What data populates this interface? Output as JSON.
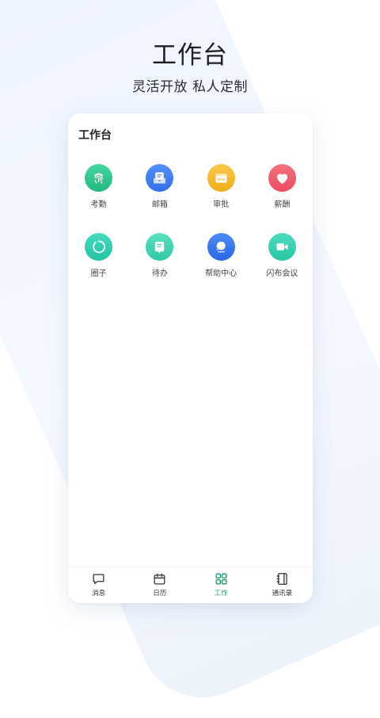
{
  "hero": {
    "title": "工作台",
    "subtitle": "灵活开放 私人定制"
  },
  "screen": {
    "title": "工作台"
  },
  "apps": [
    {
      "label": "考勤",
      "icon": "fingerprint-icon",
      "color": "#2fc58c"
    },
    {
      "label": "邮箱",
      "icon": "mail-icon",
      "color": "#3d7cf3"
    },
    {
      "label": "审批",
      "icon": "approval-icon",
      "color": "#f6ba2a"
    },
    {
      "label": "薪酬",
      "icon": "heart-icon",
      "color": "#f05a6a"
    },
    {
      "label": "圈子",
      "icon": "circle-icon",
      "color": "#31cfb2"
    },
    {
      "label": "待办",
      "icon": "todo-icon",
      "color": "#38d1ad"
    },
    {
      "label": "帮助中心",
      "icon": "help-icon",
      "color": "#3577ef"
    },
    {
      "label": "闪布会议",
      "icon": "video-icon",
      "color": "#34d2ad"
    }
  ],
  "approval_icon_text": "BPM",
  "tabs": [
    {
      "label": "消息",
      "icon": "message-icon",
      "active": false
    },
    {
      "label": "日历",
      "icon": "calendar-icon",
      "active": false
    },
    {
      "label": "工作",
      "icon": "work-grid-icon",
      "active": true
    },
    {
      "label": "通讯录",
      "icon": "contacts-icon",
      "active": false
    }
  ],
  "colors": {
    "active_tab": "#1f9e6c",
    "inactive_tab": "#333333"
  }
}
